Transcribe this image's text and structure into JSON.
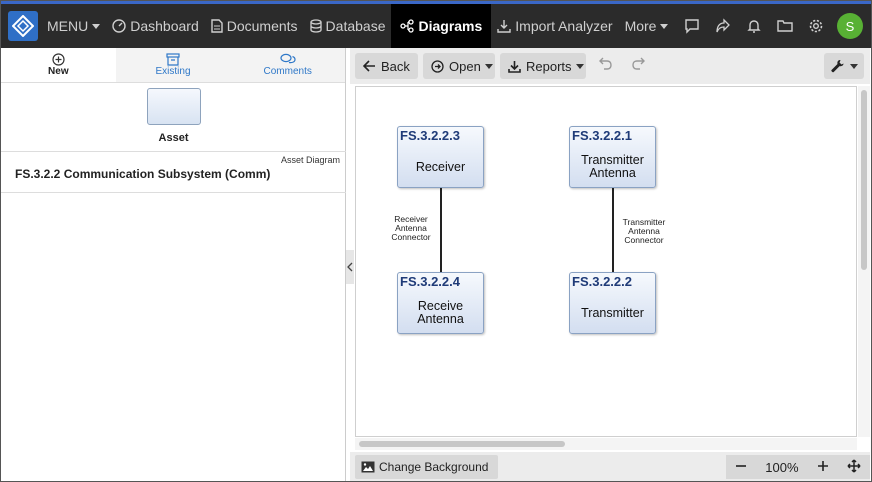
{
  "nav": {
    "menu_label": "MENU",
    "items": [
      {
        "label": "Dashboard",
        "icon": "gauge-icon"
      },
      {
        "label": "Documents",
        "icon": "document-icon"
      },
      {
        "label": "Database",
        "icon": "database-icon"
      },
      {
        "label": "Diagrams",
        "icon": "diagram-icon",
        "active": true
      },
      {
        "label": "Import Analyzer",
        "icon": "import-icon"
      },
      {
        "label": "More",
        "icon": ""
      }
    ],
    "user_initial": "S",
    "accent": "#3a67c7",
    "avatar_color": "#58b134"
  },
  "left_tabs": [
    {
      "label": "New",
      "icon": "plus-circle-icon"
    },
    {
      "label": "Existing",
      "icon": "archive-icon"
    },
    {
      "label": "Comments",
      "icon": "comments-icon"
    }
  ],
  "asset": {
    "label": "Asset"
  },
  "diagram_item": {
    "type": "Asset Diagram",
    "name": "FS.3.2.2 Communication Subsystem (Comm)"
  },
  "toolbar": {
    "back": "Back",
    "open": "Open",
    "reports": "Reports"
  },
  "diagram": {
    "nodes": [
      {
        "id": "FS.3.2.2.3",
        "name": "Receiver"
      },
      {
        "id": "FS.3.2.2.1",
        "name": "Transmitter Antenna"
      },
      {
        "id": "FS.3.2.2.4",
        "name": "Receive Antenna"
      },
      {
        "id": "FS.3.2.2.2",
        "name": "Transmitter"
      }
    ],
    "connectors": [
      {
        "label": "Receiver Antenna Connector"
      },
      {
        "label": "Transmitter Antenna Connector"
      }
    ]
  },
  "bottom": {
    "change_bg": "Change Background",
    "zoom": "100%"
  }
}
